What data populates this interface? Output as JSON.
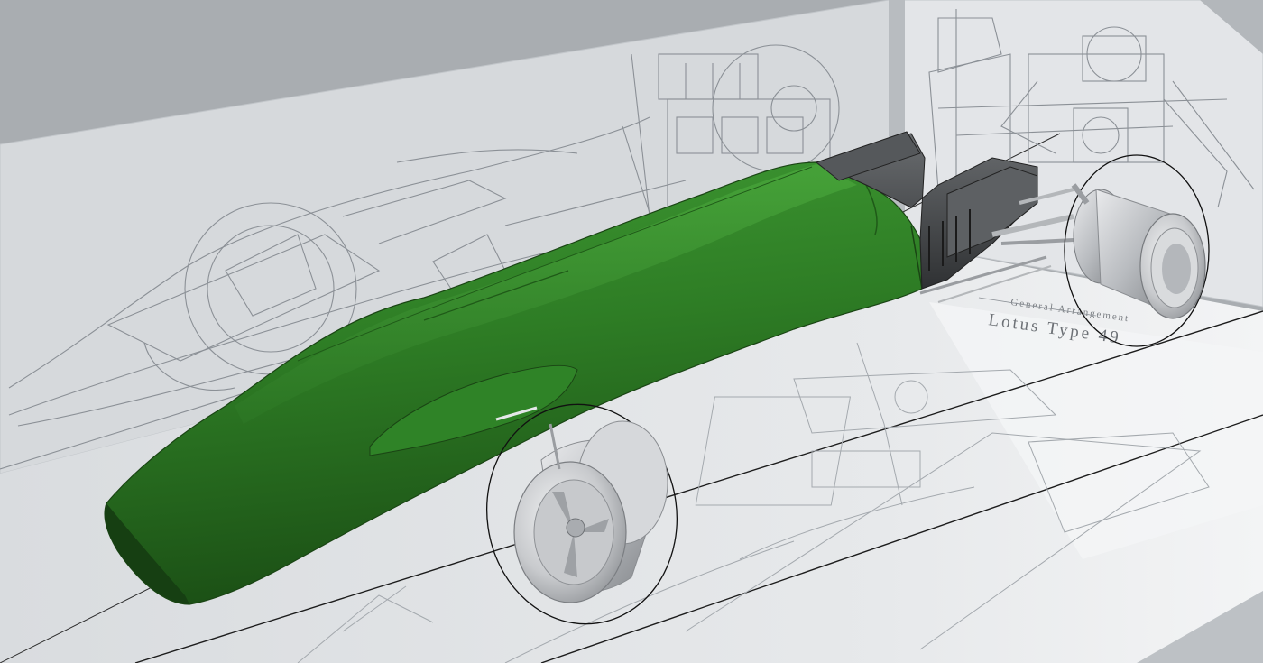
{
  "viewport": {
    "colors": {
      "background": "#a9adb1",
      "wall": "#d5d8dc",
      "floor": "#dfe2e5",
      "floor_light": "#eef0f2",
      "blueprint_line": "#8b9096",
      "body_green": "#2e7d25",
      "body_dark": "#1f5a18",
      "body_light": "#3f9a33",
      "wheel": "#c9cbce",
      "engine": "#4a4d50"
    },
    "blueprint": {
      "title": "Lotus Type 49",
      "subtitle": "General Arrangement"
    },
    "model": {
      "body_icon": "car-body-green",
      "engine_icon": "engine-block-dark",
      "wheel_icon": "wheel-rim-silver"
    }
  }
}
